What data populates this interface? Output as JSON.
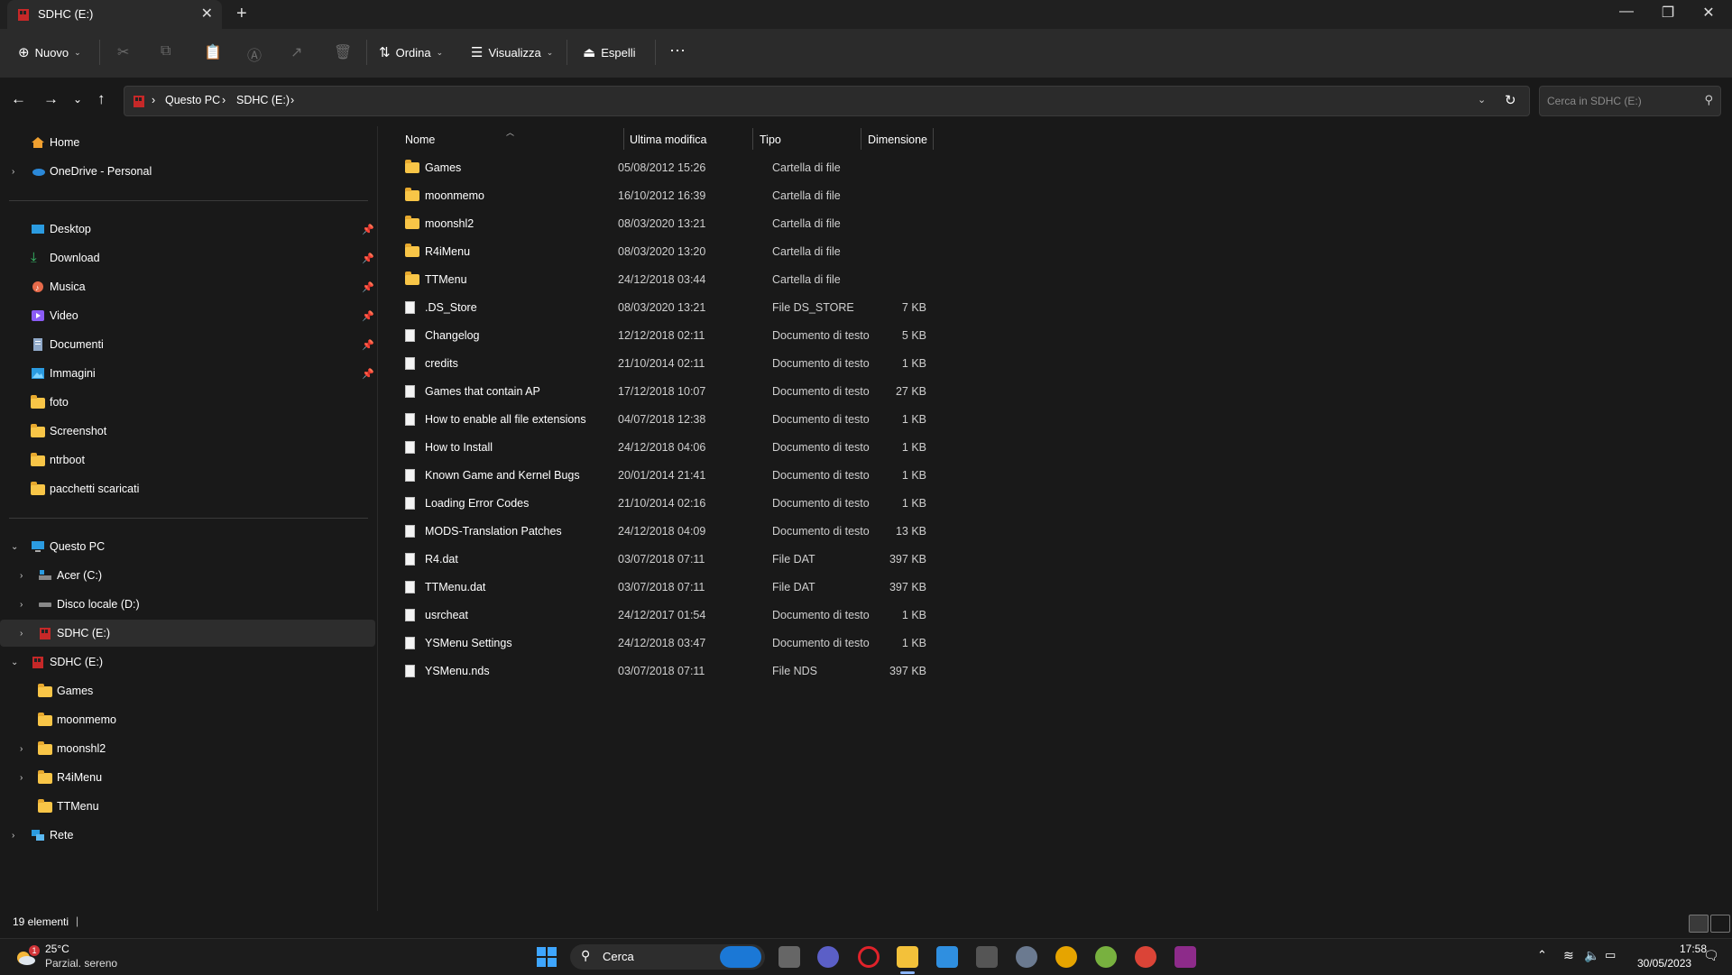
{
  "window": {
    "tab_title": "SDHC (E:)",
    "tab_close": "✕",
    "new_tab": "+",
    "controls": {
      "minimize": "—",
      "maximize": "❐",
      "close": "✕"
    }
  },
  "toolbar": {
    "new_label": "Nuovo",
    "sort_label": "Ordina",
    "view_label": "Visualizza",
    "eject_label": "Espelli",
    "more": "···"
  },
  "address": {
    "crumbs": [
      "Questo PC",
      "SDHC (E:)"
    ],
    "search_placeholder": "Cerca in SDHC (E:)"
  },
  "nav": {
    "home": "Home",
    "onedrive": "OneDrive - Personal",
    "quick": [
      {
        "label": "Desktop",
        "icon": "desktop-icon",
        "pinned": true
      },
      {
        "label": "Download",
        "icon": "download-icon",
        "pinned": true
      },
      {
        "label": "Musica",
        "icon": "music-icon",
        "pinned": true
      },
      {
        "label": "Video",
        "icon": "video-icon",
        "pinned": true
      },
      {
        "label": "Documenti",
        "icon": "documents-icon",
        "pinned": true
      },
      {
        "label": "Immagini",
        "icon": "pictures-icon",
        "pinned": true
      },
      {
        "label": "foto",
        "icon": "folder-icon",
        "pinned": false
      },
      {
        "label": "Screenshot",
        "icon": "folder-icon",
        "pinned": false
      },
      {
        "label": "ntrboot",
        "icon": "folder-icon",
        "pinned": false
      },
      {
        "label": "pacchetti scaricati",
        "icon": "folder-icon",
        "pinned": false
      }
    ],
    "this_pc": "Questo PC",
    "drives": [
      "Acer (C:)",
      "Disco locale (D:)",
      "SDHC (E:)"
    ],
    "sdhc": "SDHC (E:)",
    "sdhc_children": [
      {
        "label": "Games",
        "expandable": false
      },
      {
        "label": "moonmemo",
        "expandable": false
      },
      {
        "label": "moonshl2",
        "expandable": true
      },
      {
        "label": "R4iMenu",
        "expandable": true
      },
      {
        "label": "TTMenu",
        "expandable": false
      }
    ],
    "network": "Rete"
  },
  "columns": {
    "name": "Nome",
    "modified": "Ultima modifica",
    "type": "Tipo",
    "size": "Dimensione"
  },
  "files": [
    {
      "name": "Games",
      "modified": "05/08/2012 15:26",
      "type": "Cartella di file",
      "size": "",
      "kind": "folder"
    },
    {
      "name": "moonmemo",
      "modified": "16/10/2012 16:39",
      "type": "Cartella di file",
      "size": "",
      "kind": "folder"
    },
    {
      "name": "moonshl2",
      "modified": "08/03/2020 13:21",
      "type": "Cartella di file",
      "size": "",
      "kind": "folder"
    },
    {
      "name": "R4iMenu",
      "modified": "08/03/2020 13:20",
      "type": "Cartella di file",
      "size": "",
      "kind": "folder"
    },
    {
      "name": "TTMenu",
      "modified": "24/12/2018 03:44",
      "type": "Cartella di file",
      "size": "",
      "kind": "folder"
    },
    {
      "name": ".DS_Store",
      "modified": "08/03/2020 13:21",
      "type": "File DS_STORE",
      "size": "7 KB",
      "kind": "file"
    },
    {
      "name": "Changelog",
      "modified": "12/12/2018 02:11",
      "type": "Documento di testo",
      "size": "5 KB",
      "kind": "file"
    },
    {
      "name": "credits",
      "modified": "21/10/2014 02:11",
      "type": "Documento di testo",
      "size": "1 KB",
      "kind": "file"
    },
    {
      "name": "Games that contain AP",
      "modified": "17/12/2018 10:07",
      "type": "Documento di testo",
      "size": "27 KB",
      "kind": "file"
    },
    {
      "name": "How to enable all file extensions",
      "modified": "04/07/2018 12:38",
      "type": "Documento di testo",
      "size": "1 KB",
      "kind": "file"
    },
    {
      "name": "How to Install",
      "modified": "24/12/2018 04:06",
      "type": "Documento di testo",
      "size": "1 KB",
      "kind": "file"
    },
    {
      "name": "Known Game and Kernel Bugs",
      "modified": "20/01/2014 21:41",
      "type": "Documento di testo",
      "size": "1 KB",
      "kind": "file"
    },
    {
      "name": "Loading Error Codes",
      "modified": "21/10/2014 02:16",
      "type": "Documento di testo",
      "size": "1 KB",
      "kind": "file"
    },
    {
      "name": "MODS-Translation Patches",
      "modified": "24/12/2018 04:09",
      "type": "Documento di testo",
      "size": "13 KB",
      "kind": "file"
    },
    {
      "name": "R4.dat",
      "modified": "03/07/2018 07:11",
      "type": "File DAT",
      "size": "397 KB",
      "kind": "file"
    },
    {
      "name": "TTMenu.dat",
      "modified": "03/07/2018 07:11",
      "type": "File DAT",
      "size": "397 KB",
      "kind": "file"
    },
    {
      "name": "usrcheat",
      "modified": "24/12/2017 01:54",
      "type": "Documento di testo",
      "size": "1 KB",
      "kind": "file"
    },
    {
      "name": "YSMenu Settings",
      "modified": "24/12/2018 03:47",
      "type": "Documento di testo",
      "size": "1 KB",
      "kind": "file"
    },
    {
      "name": "YSMenu.nds",
      "modified": "03/07/2018 07:11",
      "type": "File NDS",
      "size": "397 KB",
      "kind": "file"
    }
  ],
  "status": {
    "count": "19 elementi",
    "cursor": "|"
  },
  "taskbar": {
    "weather_temp": "25°C",
    "weather_desc": "Parzial. sereno",
    "weather_badge": "1",
    "search_label": "Cerca",
    "time": "17:58",
    "date": "30/05/2023",
    "apps": [
      "start-icon",
      "bing-icon",
      "task-view-icon",
      "teams-icon",
      "opera-icon",
      "file-explorer-icon",
      "store-icon",
      "app-icon",
      "settings-icon",
      "chrome-canary-icon",
      "utorrent-icon",
      "chrome-icon",
      "winrar-icon"
    ]
  },
  "colors": {
    "accent": "#0078d4",
    "folder": "#f8c547",
    "background": "#191919"
  }
}
